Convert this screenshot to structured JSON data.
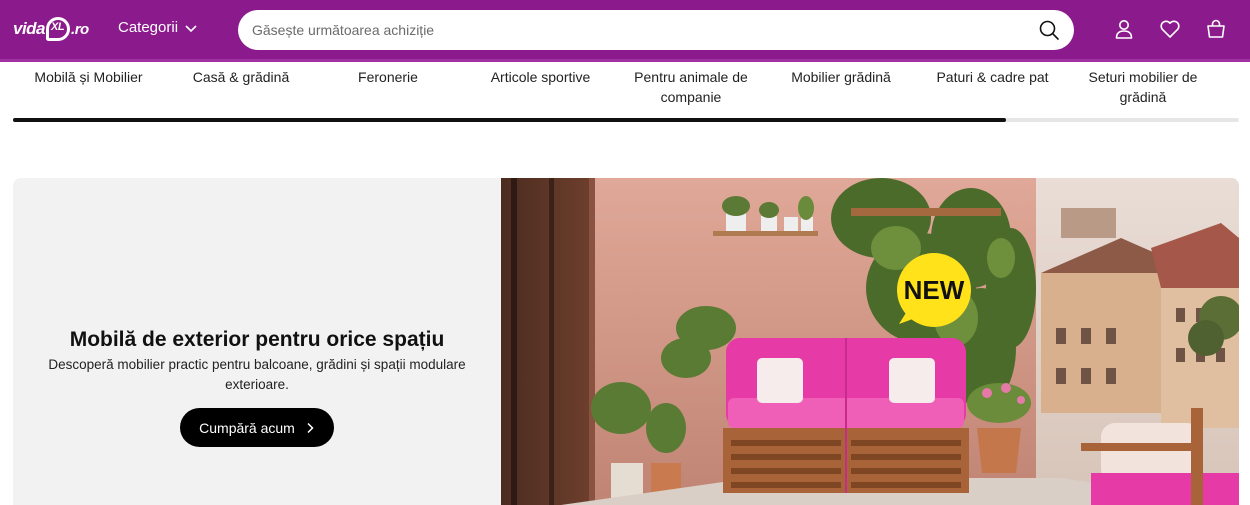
{
  "header": {
    "logo": {
      "part1": "vida",
      "part2": "",
      "part3": ".ro",
      "alt": "vidaXL.ro"
    },
    "categories_label": "Categorii",
    "search": {
      "placeholder": "Găsește următoarea achiziție",
      "value": ""
    },
    "icons": [
      "search-icon",
      "account-icon",
      "heart-icon",
      "cart-icon"
    ]
  },
  "nav": {
    "items": [
      {
        "label": "Mobilă și Mobilier"
      },
      {
        "label": "Casă & grădină"
      },
      {
        "label": "Feronerie"
      },
      {
        "label": "Articole sportive"
      },
      {
        "label": "Pentru animale de companie"
      },
      {
        "label": "Mobilier grădină"
      },
      {
        "label": "Paturi & cadre pat"
      },
      {
        "label": "Seturi mobilier de grădină"
      }
    ],
    "scroll_fraction": 0.81
  },
  "hero": {
    "title": "Mobilă de exterior pentru orice spațiu",
    "subtitle": "Descoperă mobilier practic pentru balcoane, grădini și spații modulare exterioare.",
    "cta_label": "Cumpără acum",
    "badge": "NEW",
    "colors": {
      "brand": "#8b1a8c",
      "badge": "#ffe21a",
      "cushion": "#e63aa6"
    }
  }
}
